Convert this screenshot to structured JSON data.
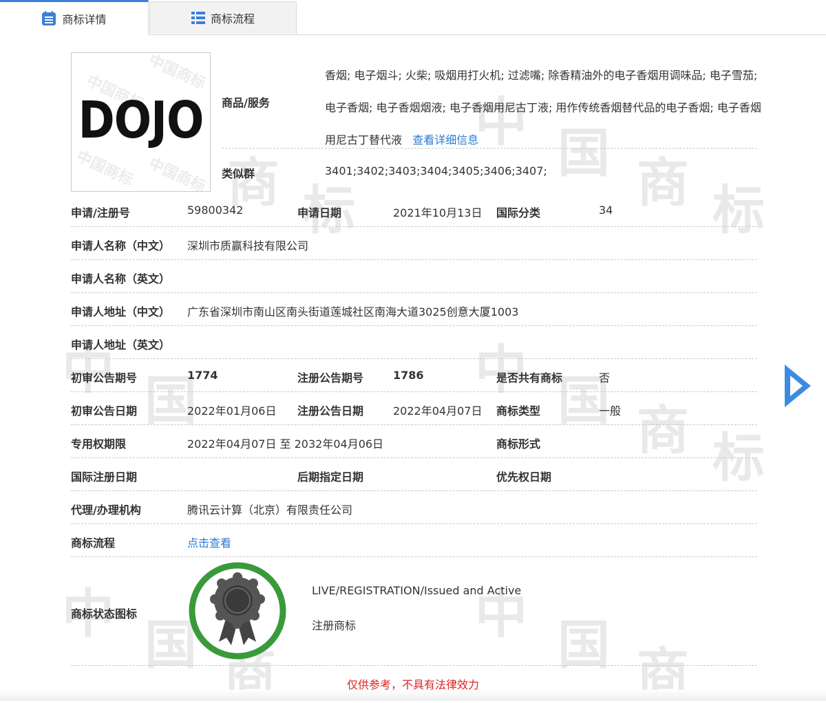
{
  "tabs": [
    {
      "label": "商标详情",
      "active": true
    },
    {
      "label": "商标流程",
      "active": false
    }
  ],
  "logo": {
    "text": "DOJO",
    "watermark": "中国商标"
  },
  "goods": {
    "label": "商品/服务",
    "text": "香烟; 电子烟斗; 火柴; 吸烟用打火机; 过滤嘴; 除香精油外的电子香烟用调味品; 电子雪茄; 电子香烟; 电子香烟烟液; 电子香烟用尼古丁液; 用作传统香烟替代品的电子香烟; 电子香烟用尼古丁替代液",
    "more_link": "查看详细信息"
  },
  "similar_group": {
    "label": "类似群",
    "value": "3401;3402;3403;3404;3405;3406;3407;"
  },
  "reg_no": {
    "label": "申请/注册号",
    "value": "59800342"
  },
  "app_date": {
    "label": "申请日期",
    "value": "2021年10月13日"
  },
  "intl_class": {
    "label": "国际分类",
    "value": "34"
  },
  "applicant_cn": {
    "label": "申请人名称（中文）",
    "value": "深圳市质赢科技有限公司"
  },
  "applicant_en": {
    "label": "申请人名称（英文）",
    "value": ""
  },
  "address_cn": {
    "label": "申请人地址（中文）",
    "value": "广东省深圳市南山区南头街道莲城社区南海大道3025创意大厦1003"
  },
  "address_en": {
    "label": "申请人地址（英文）",
    "value": ""
  },
  "prelim_issue": {
    "label": "初审公告期号",
    "value": "1774"
  },
  "reg_issue": {
    "label": "注册公告期号",
    "value": "1786"
  },
  "shared": {
    "label": "是否共有商标",
    "value": "否"
  },
  "prelim_date": {
    "label": "初审公告日期",
    "value": "2022年01月06日"
  },
  "reg_date": {
    "label": "注册公告日期",
    "value": "2022年04月07日"
  },
  "tm_type": {
    "label": "商标类型",
    "value": "一般"
  },
  "exclusive": {
    "label": "专用权期限",
    "value": "2022年04月07日 至 2032年04月06日"
  },
  "tm_form": {
    "label": "商标形式",
    "value": ""
  },
  "intl_reg_date": {
    "label": "国际注册日期",
    "value": ""
  },
  "later_date": {
    "label": "后期指定日期",
    "value": ""
  },
  "priority_date": {
    "label": "优先权日期",
    "value": ""
  },
  "agent": {
    "label": "代理/办理机构",
    "value": "腾讯云计算（北京）有限责任公司"
  },
  "process": {
    "label": "商标流程",
    "link": "点击查看"
  },
  "status": {
    "label": "商标状态图标",
    "en": "LIVE/REGISTRATION/Issued and Active",
    "cn": "注册商标"
  },
  "disclaimer": "仅供参考，不具有法律效力",
  "watermark": {
    "zhong": "中",
    "guo": "国",
    "shang": "商",
    "biao": "标"
  },
  "colors": {
    "accent": "#3b7fd9",
    "link": "#2a7bd6",
    "seal_ring": "#3a9a3a",
    "disclaimer": "#e02020"
  }
}
